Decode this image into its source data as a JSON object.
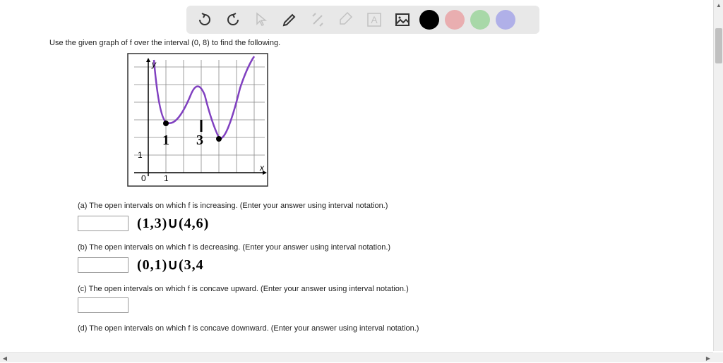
{
  "toolbar": {
    "colors": {
      "black": "#000000",
      "pink": "#e9aeb0",
      "green": "#a8d8a8",
      "purple": "#b0b0e8"
    }
  },
  "instruction": "Use the given graph of f over the interval (0, 8) to find the following.",
  "graph": {
    "y_label": "y",
    "x_label": "x",
    "origin_label": "0",
    "x_tick": "1",
    "y_tick": "1",
    "annotations": {
      "one": "1",
      "three": "3"
    }
  },
  "questions": {
    "a": {
      "text": "(a) The open intervals on which f is increasing. (Enter your answer using interval notation.)",
      "handwritten": "(1,3)∪(4,6)"
    },
    "b": {
      "text": "(b) The open intervals on which f is decreasing. (Enter your answer using interval notation.)",
      "handwritten": "(0,1)∪(3,4"
    },
    "c": {
      "text": "(c) The open intervals on which f is concave upward. (Enter your answer using interval notation.)"
    },
    "d": {
      "text": "(d) The open intervals on which f is concave downward. (Enter your answer using interval notation.)"
    }
  }
}
